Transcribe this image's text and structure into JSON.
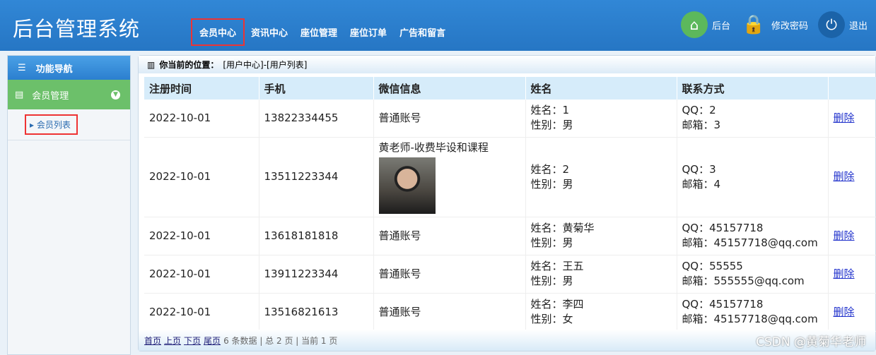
{
  "header": {
    "title": "后台管理系统",
    "nav": [
      "会员中心",
      "资讯中心",
      "座位管理",
      "座位订单",
      "广告和留言"
    ],
    "tools": {
      "home": "后台",
      "password": "修改密码",
      "logout": "退出"
    }
  },
  "sidebar": {
    "title": "功能导航",
    "group": "会员管理",
    "item": "会员列表"
  },
  "breadcrumb": {
    "label": "你当前的位置：",
    "path": "[用户中心]-[用户列表]"
  },
  "table": {
    "headers": [
      "注册时间",
      "手机",
      "微信信息",
      "姓名",
      "联系方式",
      ""
    ],
    "rows": [
      {
        "date": "2022-10-01",
        "phone": "13822334455",
        "wechat": "普通账号",
        "name": "姓名：1",
        "gender": "性别：男",
        "qq": "QQ：2",
        "email": "邮箱：3",
        "action": "删除"
      },
      {
        "date": "2022-10-01",
        "phone": "13511223344",
        "wechat": "黄老师-收费毕设和课程",
        "name": "姓名：2",
        "gender": "性别：男",
        "qq": "QQ：3",
        "email": "邮箱：4",
        "action": "删除"
      },
      {
        "date": "2022-10-01",
        "phone": "13618181818",
        "wechat": "普通账号",
        "name": "姓名：黄菊华",
        "gender": "性别：男",
        "qq": "QQ：45157718",
        "email": "邮箱：45157718@qq.com",
        "action": "删除"
      },
      {
        "date": "2022-10-01",
        "phone": "13911223344",
        "wechat": "普通账号",
        "name": "姓名：王五",
        "gender": "性别：男",
        "qq": "QQ：55555",
        "email": "邮箱：555555@qq.com",
        "action": "删除"
      },
      {
        "date": "2022-10-01",
        "phone": "13516821613",
        "wechat": "普通账号",
        "name": "姓名：李四",
        "gender": "性别：女",
        "qq": "QQ：45157718",
        "email": "邮箱：45157718@qq.com",
        "action": "删除"
      }
    ]
  },
  "pager": {
    "first": "首页",
    "prev": "上页",
    "next": "下页",
    "last": "尾页",
    "info": "6 条数据 | 总 2 页 | 当前 1 页"
  },
  "watermark": "CSDN @黄菊华老师"
}
